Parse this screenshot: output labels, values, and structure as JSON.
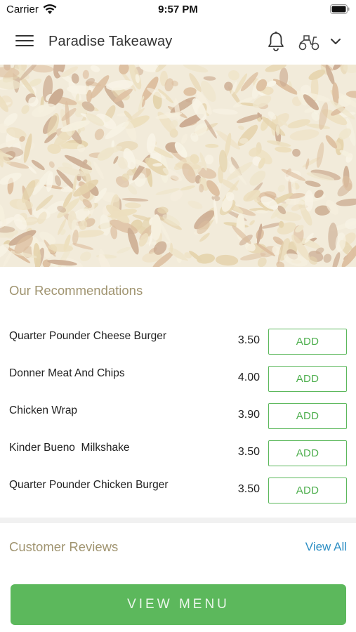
{
  "status_bar": {
    "carrier": "Carrier",
    "time": "9:57 PM",
    "icons": [
      "wifi-icon",
      "battery-icon"
    ]
  },
  "header": {
    "title": "Paradise Takeaway",
    "icons": [
      "hamburger-menu-icon",
      "bell-icon",
      "scooter-icon",
      "chevron-down-icon"
    ]
  },
  "recommendations": {
    "title": "Our Recommendations",
    "items": [
      {
        "name": "Quarter Pounder Cheese Burger",
        "price": "3.50",
        "button": "ADD"
      },
      {
        "name": "Donner Meat And Chips",
        "price": "4.00",
        "button": "ADD"
      },
      {
        "name": "Chicken Wrap",
        "price": "3.90",
        "button": "ADD"
      },
      {
        "name": "Kinder Bueno  Milkshake",
        "price": "3.50",
        "button": "ADD"
      },
      {
        "name": "Quarter Pounder Chicken Burger",
        "price": "3.50",
        "button": "ADD"
      }
    ]
  },
  "reviews": {
    "title": "Customer Reviews",
    "view_all": "View All"
  },
  "cta": {
    "label": "VIEW MENU"
  },
  "colors": {
    "accent_green": "#5cb85c",
    "section_title": "#a09470",
    "link_blue": "#2e8fc4"
  }
}
